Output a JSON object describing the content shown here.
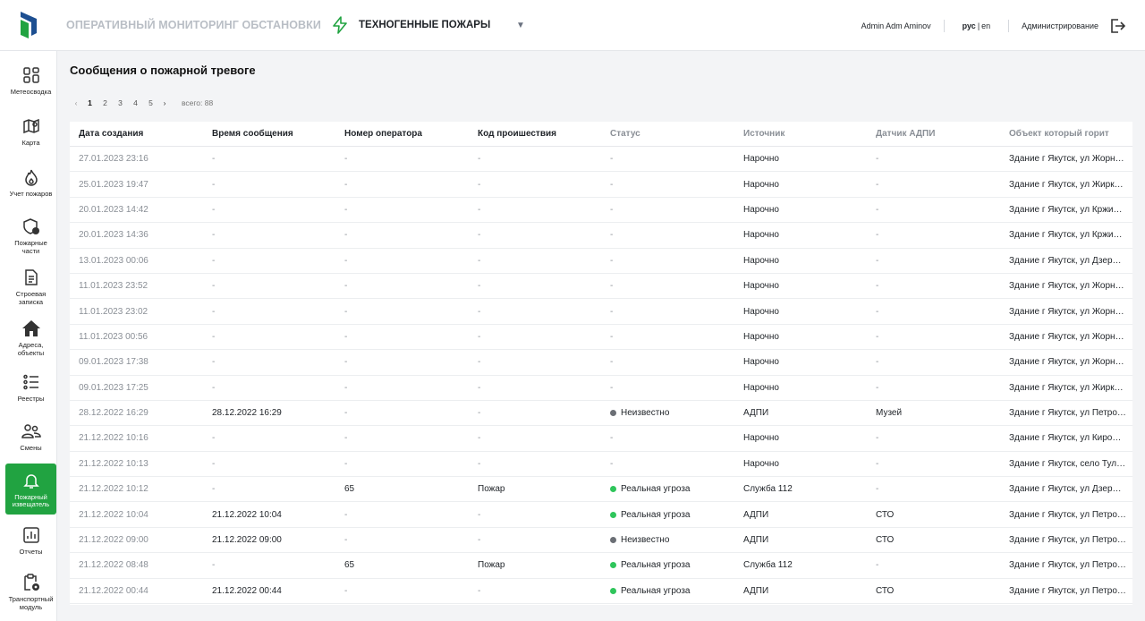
{
  "header": {
    "app_title": "ОПЕРАТИВНЫЙ МОНИТОРИНГ ОБСТАНОВКИ",
    "mode": "ТЕХНОГЕННЫЕ ПОЖАРЫ",
    "user": "Admin Adm Aminov",
    "lang_ru": "рус",
    "lang_sep": "|",
    "lang_en": "en",
    "admin": "Администрирование"
  },
  "colors": {
    "accent": "#21a341",
    "status_real": "#2fc55b",
    "status_unknown": "#6b6f75"
  },
  "sidebar": {
    "items": [
      {
        "label": "Метеосводка",
        "icon": "grid-icon"
      },
      {
        "label": "Карта",
        "icon": "map-icon"
      },
      {
        "label": "Учет пожаров",
        "icon": "fire-icon"
      },
      {
        "label": "Пожарные части",
        "icon": "shield-icon"
      },
      {
        "label": "Строевая записка",
        "icon": "document-icon"
      },
      {
        "label": "Адреса, объекты",
        "icon": "home-icon"
      },
      {
        "label": "Реестры",
        "icon": "list-icon"
      },
      {
        "label": "Смены",
        "icon": "users-icon"
      },
      {
        "label": "Пожарный извещатель",
        "icon": "bell-icon"
      },
      {
        "label": "Отчеты",
        "icon": "chart-icon"
      },
      {
        "label": "Транспортный модуль",
        "icon": "clipboard-gear-icon"
      }
    ]
  },
  "main": {
    "title": "Сообщения о пожарной тревоге",
    "pagination": {
      "prev": "‹",
      "pages": [
        "1",
        "2",
        "3",
        "4",
        "5"
      ],
      "current": "1",
      "next": "›",
      "total": "всего: 88"
    },
    "columns": [
      "Дата создания",
      "Время сообщения",
      "Номер оператора",
      "Код проишествия",
      "Статус",
      "Источник",
      "Датчик АДПИ",
      "Объект который горит"
    ],
    "rows": [
      {
        "created": "27.01.2023 23:16",
        "msg_time": "-",
        "operator": "-",
        "code": "-",
        "status": "-",
        "status_kind": "none",
        "source": "Нарочно",
        "sensor": "-",
        "object": "Здание г Якутск, ул Жорн…"
      },
      {
        "created": "25.01.2023 19:47",
        "msg_time": "-",
        "operator": "-",
        "code": "-",
        "status": "-",
        "status_kind": "none",
        "source": "Нарочно",
        "sensor": "-",
        "object": "Здание г Якутск, ул Жирк…"
      },
      {
        "created": "20.01.2023 14:42",
        "msg_time": "-",
        "operator": "-",
        "code": "-",
        "status": "-",
        "status_kind": "none",
        "source": "Нарочно",
        "sensor": "-",
        "object": "Здание г Якутск, ул Кржи…"
      },
      {
        "created": "20.01.2023 14:36",
        "msg_time": "-",
        "operator": "-",
        "code": "-",
        "status": "-",
        "status_kind": "none",
        "source": "Нарочно",
        "sensor": "-",
        "object": "Здание г Якутск, ул Кржи…"
      },
      {
        "created": "13.01.2023 00:06",
        "msg_time": "-",
        "operator": "-",
        "code": "-",
        "status": "-",
        "status_kind": "none",
        "source": "Нарочно",
        "sensor": "-",
        "object": "Здание г Якутск, ул Дзер…"
      },
      {
        "created": "11.01.2023 23:52",
        "msg_time": "-",
        "operator": "-",
        "code": "-",
        "status": "-",
        "status_kind": "none",
        "source": "Нарочно",
        "sensor": "-",
        "object": "Здание г Якутск, ул Жорн…"
      },
      {
        "created": "11.01.2023 23:02",
        "msg_time": "-",
        "operator": "-",
        "code": "-",
        "status": "-",
        "status_kind": "none",
        "source": "Нарочно",
        "sensor": "-",
        "object": "Здание г Якутск, ул Жорн…"
      },
      {
        "created": "11.01.2023 00:56",
        "msg_time": "-",
        "operator": "-",
        "code": "-",
        "status": "-",
        "status_kind": "none",
        "source": "Нарочно",
        "sensor": "-",
        "object": "Здание г Якутск, ул Жорн…"
      },
      {
        "created": "09.01.2023 17:38",
        "msg_time": "-",
        "operator": "-",
        "code": "-",
        "status": "-",
        "status_kind": "none",
        "source": "Нарочно",
        "sensor": "-",
        "object": "Здание г Якутск, ул Жорн…"
      },
      {
        "created": "09.01.2023 17:25",
        "msg_time": "-",
        "operator": "-",
        "code": "-",
        "status": "-",
        "status_kind": "none",
        "source": "Нарочно",
        "sensor": "-",
        "object": "Здание г Якутск, ул Жирк…"
      },
      {
        "created": "28.12.2022 16:29",
        "msg_time": "28.12.2022 16:29",
        "operator": "-",
        "code": "-",
        "status": "Неизвестно",
        "status_kind": "unknown",
        "source": "АДПИ",
        "sensor": "Музей",
        "object": "Здание г Якутск, ул Петро…"
      },
      {
        "created": "21.12.2022 10:16",
        "msg_time": "-",
        "operator": "-",
        "code": "-",
        "status": "-",
        "status_kind": "none",
        "source": "Нарочно",
        "sensor": "-",
        "object": "Здание г Якутск, ул Киро…"
      },
      {
        "created": "21.12.2022 10:13",
        "msg_time": "-",
        "operator": "-",
        "code": "-",
        "status": "-",
        "status_kind": "none",
        "source": "Нарочно",
        "sensor": "-",
        "object": "Здание г Якутск, село Тул…"
      },
      {
        "created": "21.12.2022 10:12",
        "msg_time": "-",
        "operator": "65",
        "code": "Пожар",
        "status": "Реальная угроза",
        "status_kind": "real",
        "source": "Служба 112",
        "sensor": "-",
        "object": "Здание г Якутск, ул Дзер…"
      },
      {
        "created": "21.12.2022 10:04",
        "msg_time": "21.12.2022 10:04",
        "operator": "-",
        "code": "-",
        "status": "Реальная угроза",
        "status_kind": "real",
        "source": "АДПИ",
        "sensor": "СТО",
        "object": "Здание г Якутск, ул Петро…"
      },
      {
        "created": "21.12.2022 09:00",
        "msg_time": "21.12.2022 09:00",
        "operator": "-",
        "code": "-",
        "status": "Неизвестно",
        "status_kind": "unknown",
        "source": "АДПИ",
        "sensor": "СТО",
        "object": "Здание г Якутск, ул Петро…"
      },
      {
        "created": "21.12.2022 08:48",
        "msg_time": "-",
        "operator": "65",
        "code": "Пожар",
        "status": "Реальная угроза",
        "status_kind": "real",
        "source": "Служба 112",
        "sensor": "-",
        "object": "Здание г Якутск, ул Петро…"
      },
      {
        "created": "21.12.2022 00:44",
        "msg_time": "21.12.2022 00:44",
        "operator": "-",
        "code": "-",
        "status": "Реальная угроза",
        "status_kind": "real",
        "source": "АДПИ",
        "sensor": "СТО",
        "object": "Здание г Якутск, ул Петро…"
      }
    ]
  }
}
